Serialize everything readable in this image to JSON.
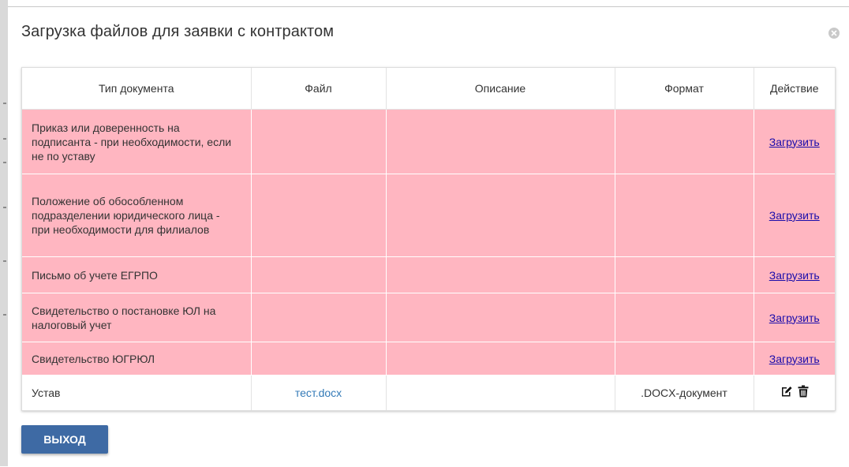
{
  "modal": {
    "title": "Загрузка файлов для заявки с контрактом"
  },
  "table": {
    "headers": [
      "Тип документа",
      "Файл",
      "Описание",
      "Формат",
      "Действие"
    ],
    "rows": [
      {
        "type": "Приказ или доверенность на подписанта - при необходимости, если не по уставу",
        "file": "",
        "description": "",
        "format": "",
        "action": "Загрузить",
        "status": "missing"
      },
      {
        "type": "Положение об обособленном подразделении юридического лица - при необходимости для филиалов",
        "file": "",
        "description": "",
        "format": "",
        "action": "Загрузить",
        "status": "missing"
      },
      {
        "type": "Письмо об учете ЕГРПО",
        "file": "",
        "description": "",
        "format": "",
        "action": "Загрузить",
        "status": "missing"
      },
      {
        "type": "Свидетельство о постановке ЮЛ на налоговый учет",
        "file": "",
        "description": "",
        "format": "",
        "action": "Загрузить",
        "status": "missing"
      },
      {
        "type": "Свидетельство ЮГРЮЛ",
        "file": "",
        "description": "",
        "format": "",
        "action": "Загрузить",
        "status": "missing"
      },
      {
        "type": "Устав",
        "file": "тест.docx",
        "description": "",
        "format": ".DOCX-документ",
        "action_icons": [
          "edit-icon",
          "trash-icon"
        ],
        "status": "ok"
      }
    ]
  },
  "footer": {
    "exit_label": "ВЫХОД"
  },
  "colors": {
    "missing_row": "#ffb6c1",
    "primary_button": "#3e6aa4",
    "link": "#1a0dab",
    "file_link": "#337ab7"
  }
}
